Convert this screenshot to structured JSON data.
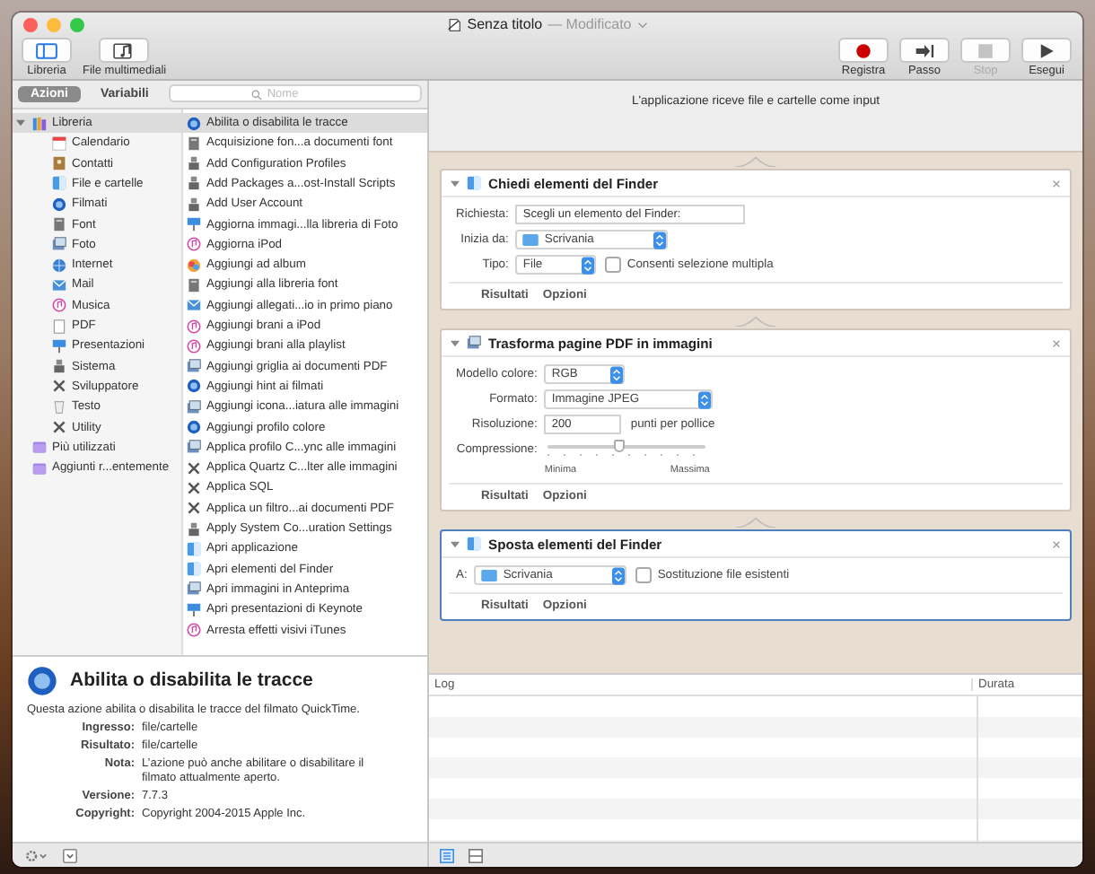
{
  "window": {
    "title": "Senza titolo",
    "subtitle": "— Modificato"
  },
  "toolbar_left": [
    {
      "label": "Libreria",
      "kind": "sidebar",
      "selected": true
    },
    {
      "label": "File multimediali",
      "kind": "media",
      "selected": false
    }
  ],
  "toolbar_right": [
    {
      "label": "Registra",
      "kind": "record",
      "disabled": false
    },
    {
      "label": "Passo",
      "kind": "step",
      "disabled": false
    },
    {
      "label": "Stop",
      "kind": "stop",
      "disabled": true
    },
    {
      "label": "Esegui",
      "kind": "run",
      "disabled": false
    }
  ],
  "tabs": [
    {
      "label": "Azioni",
      "selected": true
    },
    {
      "label": "Variabili",
      "selected": false
    }
  ],
  "search": {
    "placeholder": "Nome"
  },
  "library": [
    {
      "label": "Libreria",
      "kind": "library",
      "selected": true,
      "expanded": true,
      "children": [
        {
          "label": "Calendario",
          "kind": "calendar"
        },
        {
          "label": "Contatti",
          "kind": "contacts"
        },
        {
          "label": "File e cartelle",
          "kind": "finder"
        },
        {
          "label": "Filmati",
          "kind": "movie"
        },
        {
          "label": "Font",
          "kind": "doc"
        },
        {
          "label": "Foto",
          "kind": "preview"
        },
        {
          "label": "Internet",
          "kind": "globe"
        },
        {
          "label": "Mail",
          "kind": "mail"
        },
        {
          "label": "Musica",
          "kind": "music"
        },
        {
          "label": "PDF",
          "kind": "page"
        },
        {
          "label": "Presentazioni",
          "kind": "keynote"
        },
        {
          "label": "Sistema",
          "kind": "system"
        },
        {
          "label": "Sviluppatore",
          "kind": "tools"
        },
        {
          "label": "Testo",
          "kind": "text"
        },
        {
          "label": "Utility",
          "kind": "tools"
        }
      ]
    },
    {
      "label": "Più utilizzati",
      "kind": "folder",
      "selected": false,
      "expanded": false
    },
    {
      "label": "Aggiunti r...entemente",
      "kind": "folder",
      "selected": false,
      "expanded": false
    }
  ],
  "actions": [
    {
      "label": "Abilita o disabilita le tracce",
      "kind": "movie",
      "selected": true
    },
    {
      "label": "Acquisizione fon...a documenti font",
      "kind": "doc",
      "selected": false
    },
    {
      "label": "Add Configuration Profiles",
      "kind": "system",
      "selected": false
    },
    {
      "label": "Add Packages a...ost-Install Scripts",
      "kind": "system",
      "selected": false
    },
    {
      "label": "Add User Account",
      "kind": "system",
      "selected": false
    },
    {
      "label": "Aggiorna immagi...lla libreria di Foto",
      "kind": "keynote",
      "selected": false
    },
    {
      "label": "Aggiorna iPod",
      "kind": "music",
      "selected": false
    },
    {
      "label": "Aggiungi ad album",
      "kind": "photo",
      "selected": false
    },
    {
      "label": "Aggiungi alla libreria font",
      "kind": "doc",
      "selected": false
    },
    {
      "label": "Aggiungi allegati...io in primo piano",
      "kind": "mail",
      "selected": false
    },
    {
      "label": "Aggiungi brani a iPod",
      "kind": "music",
      "selected": false
    },
    {
      "label": "Aggiungi brani alla playlist",
      "kind": "music",
      "selected": false
    },
    {
      "label": "Aggiungi griglia ai documenti PDF",
      "kind": "preview",
      "selected": false
    },
    {
      "label": "Aggiungi hint ai filmati",
      "kind": "movie",
      "selected": false
    },
    {
      "label": "Aggiungi icona...iatura alle immagini",
      "kind": "preview",
      "selected": false
    },
    {
      "label": "Aggiungi profilo colore",
      "kind": "movie",
      "selected": false
    },
    {
      "label": "Applica profilo C...ync alle immagini",
      "kind": "preview",
      "selected": false
    },
    {
      "label": "Applica Quartz C...lter alle immagini",
      "kind": "tools",
      "selected": false
    },
    {
      "label": "Applica SQL",
      "kind": "tools",
      "selected": false
    },
    {
      "label": "Applica un filtro...ai documenti PDF",
      "kind": "tools",
      "selected": false
    },
    {
      "label": "Apply System Co...uration Settings",
      "kind": "system",
      "selected": false
    },
    {
      "label": "Apri applicazione",
      "kind": "finder",
      "selected": false
    },
    {
      "label": "Apri elementi del Finder",
      "kind": "finder",
      "selected": false
    },
    {
      "label": "Apri immagini in Anteprima",
      "kind": "preview",
      "selected": false
    },
    {
      "label": "Apri presentazioni di Keynote",
      "kind": "keynote",
      "selected": false
    },
    {
      "label": "Arresta effetti visivi iTunes",
      "kind": "music",
      "selected": false
    }
  ],
  "description": {
    "title": "Abilita o disabilita le tracce",
    "text": "Questa azione abilita o disabilita le tracce del filmato QuickTime.",
    "details": [
      {
        "key": "Ingresso:",
        "value": "file/cartelle"
      },
      {
        "key": "Risultato:",
        "value": "file/cartelle"
      },
      {
        "key": "Nota:",
        "value": "L’azione può anche abilitare o disabilitare il filmato attualmente aperto."
      },
      {
        "key": "Versione:",
        "value": "7.7.3"
      },
      {
        "key": "Copyright:",
        "value": "Copyright 2004-2015 Apple Inc."
      }
    ]
  },
  "workflow": {
    "header": "L'applicazione riceve file e cartelle come input",
    "cards": [
      {
        "title": "Chiedi elementi del Finder",
        "kind": "finder",
        "selected": false,
        "fields": [
          {
            "kind": "text",
            "label": "Richiesta:",
            "value": "Scegli un elemento del Finder:"
          },
          {
            "kind": "popup",
            "label": "Inizia da:",
            "value": "Scrivania",
            "folder": true
          },
          {
            "kind": "popup",
            "label": "Tipo:",
            "value": "File",
            "folder": false,
            "checkbox": {
              "label": "Consenti selezione multipla",
              "checked": false
            }
          }
        ],
        "footer": [
          "Risultati",
          "Opzioni"
        ]
      },
      {
        "title": "Trasforma pagine PDF in immagini",
        "kind": "preview",
        "selected": false,
        "fields": [
          {
            "kind": "popup",
            "label": "Modello colore:",
            "value": "RGB",
            "folder": false
          },
          {
            "kind": "popup",
            "label": "Formato:",
            "value": "Immagine JPEG",
            "folder": false
          },
          {
            "kind": "text",
            "label": "Risoluzione:",
            "value": "200",
            "suffix": "punti per pollice"
          },
          {
            "kind": "slider",
            "label": "Compressione:",
            "level": 0.45,
            "min_label": "Minima",
            "max_label": "Massima"
          }
        ],
        "footer": [
          "Risultati",
          "Opzioni"
        ]
      },
      {
        "title": "Sposta elementi del Finder",
        "kind": "finder",
        "selected": true,
        "fields": [
          {
            "kind": "popup",
            "label": "A:",
            "value": "Scrivania",
            "folder": true,
            "checkbox": {
              "label": "Sostituzione file esistenti",
              "checked": false
            }
          }
        ],
        "footer": [
          "Risultati",
          "Opzioni"
        ]
      }
    ]
  },
  "log": {
    "columns": [
      "Log",
      "Durata"
    ]
  }
}
